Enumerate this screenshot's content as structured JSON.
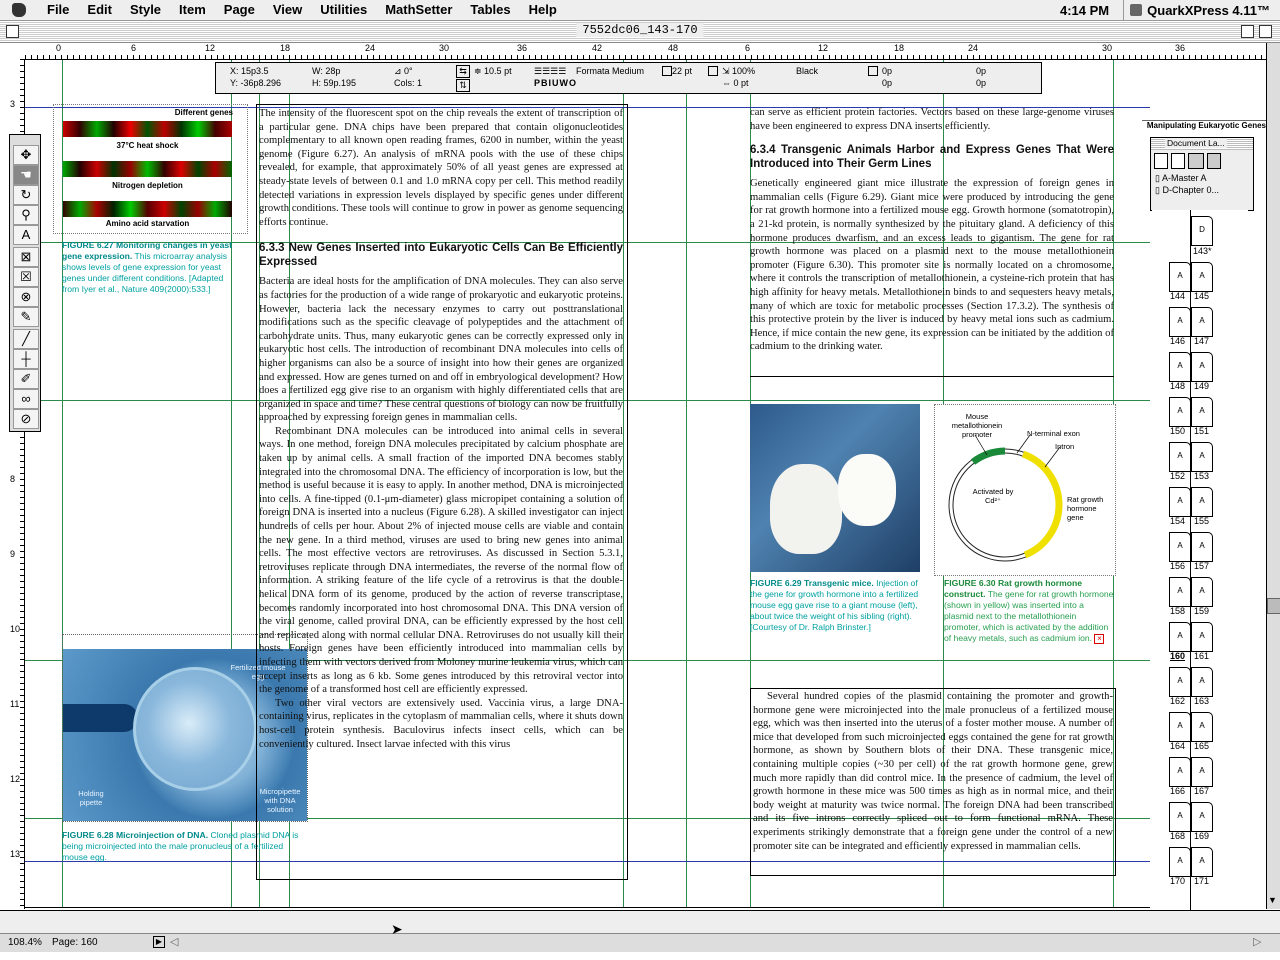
{
  "menubar": {
    "items": [
      "File",
      "Edit",
      "Style",
      "Item",
      "Page",
      "View",
      "Utilities",
      "MathSetter",
      "Tables",
      "Help"
    ],
    "time": "4:14 PM",
    "app": "QuarkXPress 4.11™"
  },
  "window": {
    "title": "7552dc06_143-170"
  },
  "ruler": {
    "h": [
      "0",
      "6",
      "12",
      "18",
      "24",
      "30",
      "36",
      "42",
      "48",
      "6",
      "12",
      "18",
      "24",
      "30",
      "36"
    ],
    "v": [
      "3",
      "4",
      "5",
      "6",
      "7",
      "8",
      "9",
      "10",
      "11",
      "12",
      "13",
      "14",
      "15"
    ]
  },
  "measurements": {
    "x": "X: 15p3.5",
    "y": "Y: -36p8.296",
    "w": "W: 28p",
    "h": "H: 59p.195",
    "angle": "0°",
    "cols": "Cols: 1",
    "leading": "10.5 pt",
    "font": "Formata Medium",
    "size": "22 pt",
    "scale": "100%",
    "kern": "0 pt",
    "color": "Black",
    "shade1": "0p",
    "shade2": "0p",
    "shade3": "0p",
    "shade4": "0p"
  },
  "figure_627": {
    "header": "Different genes",
    "rows": [
      "37°C heat shock",
      "Nitrogen depletion",
      "Amino acid starvation"
    ],
    "caption_bold": "FIGURE 6.27 Monitoring changes in yeast gene expression.",
    "caption": "This microarray analysis shows levels of gene expression for yeast genes under different conditions. [Adapted from Iyer et al., Nature 409(2000):533.]"
  },
  "figure_628": {
    "labels": [
      "Fertilized mouse egg",
      "Holding pipette",
      "Micropipette with DNA solution"
    ],
    "caption_bold": "FIGURE 6.28 Microinjection of DNA.",
    "caption": "Cloned plasmid DNA is being microinjected into the male pronucleus of a fertilized mouse egg."
  },
  "column_mid": {
    "para1": "The intensity of the fluorescent spot on the chip reveals the extent of transcription of a particular gene. DNA chips have been prepared that contain oligonucleotides complementary to all known open reading frames, 6200 in number, within the yeast genome (Figure 6.27). An analysis of mRNA pools with the use of these chips revealed, for example, that approximately 50% of all yeast genes are expressed at steady-state levels of between 0.1 and 1.0 mRNA copy per cell. This method readily detected variations in expression levels displayed by specific genes under different growth conditions. These tools will continue to grow in power as genome sequencing efforts continue.",
    "heading": "6.3.3 New Genes Inserted into Eukaryotic Cells Can Be Efficiently Expressed",
    "para2": "Bacteria are ideal hosts for the amplification of DNA molecules. They can also serve as factories for the production of a wide range of prokaryotic and eukaryotic proteins. However, bacteria lack the necessary enzymes to carry out posttranslational modifications such as the specific cleavage of polypeptides and the attachment of carbohydrate units. Thus, many eukaryotic genes can be correctly expressed only in eukaryotic host cells. The introduction of recombinant DNA molecules into cells of higher organisms can also be a source of insight into how their genes are organized and expressed. How are genes turned on and off in embryological development? How does a fertilized egg give rise to an organism with highly differentiated cells that are organized in space and time? These central questions of biology can now be fruitfully approached by expressing foreign genes in mammalian cells.",
    "para3": "Recombinant DNA molecules can be introduced into animal cells in several ways. In one method, foreign DNA molecules precipitated by calcium phosphate are taken up by animal cells. A small fraction of the imported DNA becomes stably integrated into the chromosomal DNA. The efficiency of incorporation is low, but the method is useful because it is easy to apply. In another method, DNA is microinjected into cells. A fine-tipped (0.1-μm-diameter) glass micropipet containing a solution of foreign DNA is inserted into a nucleus (Figure 6.28). A skilled investigator can inject hundreds of cells per hour. About 2% of injected mouse cells are viable and contain the new gene. In a third method, viruses are used to bring new genes into animal cells. The most effective vectors are retroviruses. As discussed in Section 5.3.1, retroviruses replicate through DNA intermediates, the reverse of the normal flow of information. A striking feature of the life cycle of a retrovirus is that the double-helical DNA form of its genome, produced by the action of reverse transcriptase, becomes randomly incorporated into host chromosomal DNA. This DNA version of the viral genome, called proviral DNA, can be efficiently expressed by the host cell and replicated along with normal cellular DNA. Retroviruses do not usually kill their hosts. Foreign genes have been efficiently introduced into mammalian cells by infecting them with vectors derived from Moloney murine leukemia virus, which can accept inserts as long as 6 kb. Some genes introduced by this retroviral vector into the genome of a transformed host cell are efficiently expressed.",
    "para4": "Two other viral vectors are extensively used. Vaccinia virus, a large DNA-containing virus, replicates in the cytoplasm of mammalian cells, where it shuts down host-cell protein synthesis. Baculovirus infects insect cells, which can be conveniently cultured. Insect larvae infected with this virus"
  },
  "column_right": {
    "para1": "can serve as efficient protein factories. Vectors based on these large-genome viruses have been engineered to express DNA inserts efficiently.",
    "heading": "6.3.4 Transgenic Animals Harbor and Express Genes That Were Introduced into Their Germ Lines",
    "para2": "Genetically engineered giant mice illustrate the expression of foreign genes in mammalian cells (Figure 6.29). Giant mice were produced by introducing the gene for rat growth hormone into a fertilized mouse egg. Growth hormone (somatotropin), a 21-kd protein, is normally synthesized by the pituitary gland. A deficiency of this hormone produces dwarfism, and an excess leads to gigantism. The gene for rat growth hormone was placed on a plasmid next to the mouse metallothionein promoter (Figure 6.30). This promoter site is normally located on a chromosome, where it controls the transcription of metallothionein, a cysteine-rich protein that has high affinity for heavy metals. Metallothionein binds to and sequesters heavy metals, many of which are toxic for metabolic processes (Section 17.3.2). The synthesis of this protective protein by the liver is induced by heavy metal ions such as cadmium. Hence, if mice contain the new gene, its expression can be initiated by the addition of cadmium to the drinking water.",
    "para3": "Several hundred copies of the plasmid containing the promoter and growth-hormone gene were microinjected into the male pronucleus of a fertilized mouse egg, which was then inserted into the uterus of a foster mother mouse. A number of mice that developed from such microinjected eggs contained the gene for rat growth hormone, as shown by Southern blots of their DNA. These transgenic mice, containing multiple copies (~30 per cell) of the rat growth hormone gene, grew much more rapidly than did control mice. In the presence of cadmium, the level of growth hormone in these mice was 500 times as high as in normal mice, and their body weight at maturity was twice normal. The foreign DNA had been transcribed and its five introns correctly spliced out to form functional mRNA. These experiments strikingly demonstrate that a foreign gene under the control of a new promoter site can be integrated and efficiently expressed in mammalian cells."
  },
  "figure_629": {
    "caption_bold": "FIGURE 6.29 Transgenic mice.",
    "caption": "Injection of the gene for growth hormone into a fertilized mouse egg gave rise to a giant mouse (left), about twice the weight of his sibling (right). [Courtesy of Dr. Ralph Brinster.]"
  },
  "figure_630": {
    "labels": [
      "Mouse metallothionein promoter",
      "N-terminal exon",
      "Intron",
      "Activated by Cd²⁺",
      "Rat growth hormone gene"
    ],
    "caption_bold": "FIGURE 6.30 Rat growth hormone construct.",
    "caption": "The gene for rat growth hormone (shown in yellow) was inserted into a plasmid next to the metallothionein promoter, which is activated by the addition of heavy metals, such as cadmium ion."
  },
  "doclayout": {
    "title": "Document La...",
    "masters": [
      "A-Master A",
      "D-Chapter 0..."
    ],
    "slug": "Manipulating Eukaryotic Genes"
  },
  "pages": {
    "first": "143*",
    "rows": [
      [
        "144",
        "145"
      ],
      [
        "146",
        "147"
      ],
      [
        "148",
        "149"
      ],
      [
        "150",
        "151"
      ],
      [
        "152",
        "153"
      ],
      [
        "154",
        "155"
      ],
      [
        "156",
        "157"
      ],
      [
        "158",
        "159"
      ],
      [
        "160",
        "161"
      ],
      [
        "162",
        "163"
      ],
      [
        "164",
        "165"
      ],
      [
        "166",
        "167"
      ],
      [
        "168",
        "169"
      ],
      [
        "170",
        "171"
      ]
    ],
    "current": "160"
  },
  "status": {
    "zoom": "108.4%",
    "page": "Page: 160"
  }
}
